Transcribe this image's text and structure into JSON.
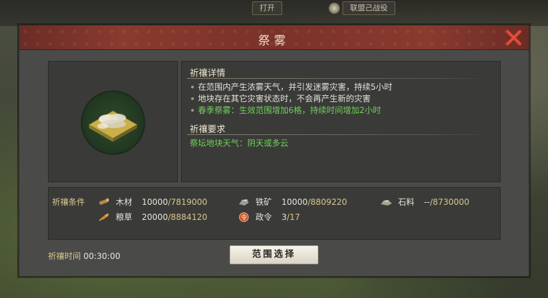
{
  "top_bar": {
    "tab1": "打开",
    "tab2": "联盟己战役"
  },
  "dialog": {
    "title": "祭雾"
  },
  "details": {
    "heading": "祈禳详情",
    "lines": [
      "在范围内产生浓雾天气，并引发迷雾灾害，持续5小时",
      "地块存在其它灾害状态时，不会再产生新的灾害",
      "春季祭雾：生效范围增加6格，持续时间增加2小时"
    ]
  },
  "requirements": {
    "heading": "祈禳要求",
    "text": "祭坛地块天气：阴天或多云"
  },
  "cost": {
    "label": "祈禳条件",
    "wood": {
      "name": "木材",
      "need": "10000",
      "have": "/7819000",
      "icon": "wood-icon"
    },
    "iron": {
      "name": "铁矿",
      "need": "10000",
      "have": "/8809220",
      "icon": "iron-ore-icon"
    },
    "stone": {
      "name": "石料",
      "need": "--",
      "have": "/8730000",
      "icon": "stone-icon"
    },
    "grain": {
      "name": "粮草",
      "need": "20000",
      "have": "/8884120",
      "icon": "grain-icon"
    },
    "order": {
      "name": "政令",
      "need": "3",
      "have": "/17",
      "icon": "decree-icon"
    }
  },
  "footer": {
    "time_label": "祈禳时间",
    "time_value": "00:30:00",
    "range_button": "范围选择"
  },
  "colors": {
    "accent_gold": "#d9c68f",
    "highlight_green": "#6fcf5a",
    "header_red": "#8a3a2f"
  }
}
